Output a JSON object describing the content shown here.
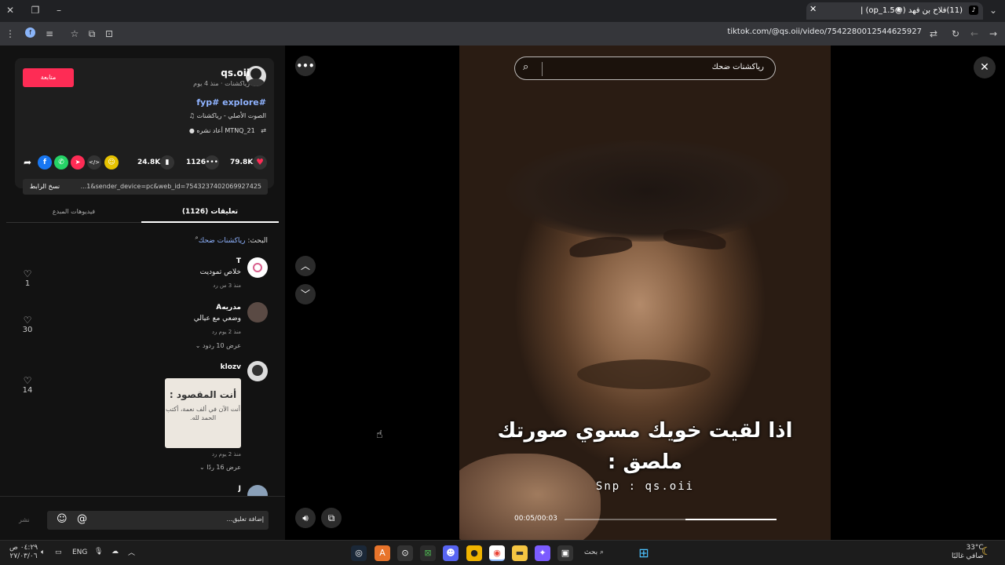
{
  "browser": {
    "tab_title": "(11)فلاح بن فهد (@op_1.5) |",
    "tab_favicon": "♪",
    "url": "tiktok.com/@qs.oii/video/7542280012544625927",
    "new_tab": "+",
    "window_min": "–",
    "window_restore": "❐",
    "window_close": "✕"
  },
  "post": {
    "username": "qs.oii",
    "meta": "رياكشنات · منذ 4 يوم",
    "follow_label": "متابعة",
    "hashtags": "fyp# explore#",
    "sound": "الصوت الأصلي - رياكشنات",
    "repost": "MTNQ_21 أعاد نشره",
    "likes": "79.8K",
    "comments": "1126",
    "saves": "24.8K",
    "link": "...1&sender_device=pc&web_id=7543237402069927425",
    "copy_link_label": "نسخ الرابط"
  },
  "tabs": {
    "comments": "(1126) تعليقات",
    "videos": "فيديوهات المبدع"
  },
  "search": {
    "prefix": "البحث:",
    "term": "رياكشنات ضحك"
  },
  "comments": [
    {
      "name": "T",
      "text": "خلاص تموديت",
      "meta": "منذ 3 س   رد",
      "likes": "1"
    },
    {
      "name": "مدريهA",
      "text": "وضعي مع عيالي",
      "meta": "منذ 2 يوم   رد",
      "more": "عرض 10 ردود",
      "likes": "30"
    },
    {
      "name": "klozv",
      "meta": "منذ 2 يوم   رد",
      "more": "عرض 16 ردًا",
      "likes": "14",
      "sticker_title": "أنت المقصود :",
      "sticker_body": "أنت الآن في ألف نعمة، أكتب الحمد لله."
    },
    {
      "name": "J"
    }
  ],
  "composer": {
    "placeholder": "إضافة تعليق...",
    "post_label": "نشر"
  },
  "video": {
    "search_text": "رياكشنات ضحك",
    "caption_line1": "اذا لقيت خويك مسوي صورتك",
    "caption_line2": "ملصق :",
    "watermark": "Snp : qs.oii",
    "time": "00:05/00:03",
    "progress": 0.43
  },
  "taskbar": {
    "search_label": "بحث",
    "language": "ENG",
    "time": "٠٤:٢٩ ص",
    "date": "٢٧/٠٣/٠٦",
    "weather_temp": "33°C",
    "weather_desc": "صافي غالبًا"
  }
}
